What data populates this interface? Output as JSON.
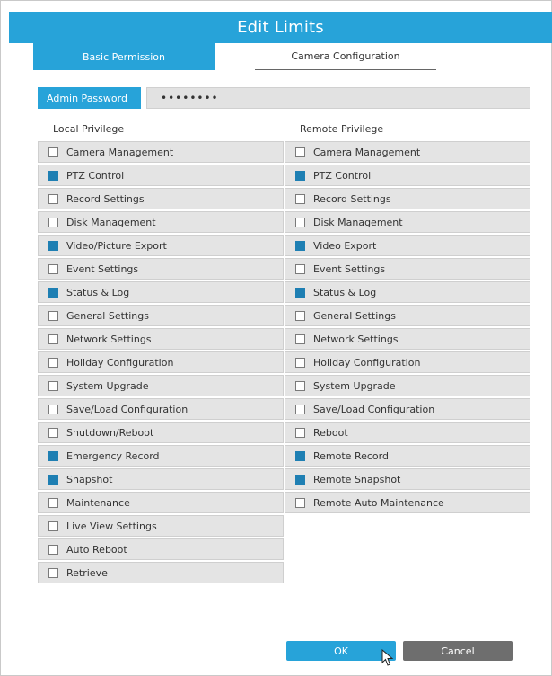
{
  "dialog": {
    "title": "Edit Limits",
    "tabs": [
      "Basic Permission",
      "Camera Configuration"
    ],
    "password_label": "Admin Password",
    "password_value": "••••••••",
    "local_title": "Local Privilege",
    "remote_title": "Remote Privilege",
    "ok": "OK",
    "cancel": "Cancel"
  },
  "local": [
    {
      "label": "Camera Management",
      "checked": false
    },
    {
      "label": "PTZ Control",
      "checked": true
    },
    {
      "label": "Record Settings",
      "checked": false
    },
    {
      "label": "Disk Management",
      "checked": false
    },
    {
      "label": "Video/Picture Export",
      "checked": true
    },
    {
      "label": "Event Settings",
      "checked": false
    },
    {
      "label": "Status & Log",
      "checked": true
    },
    {
      "label": "General Settings",
      "checked": false
    },
    {
      "label": "Network Settings",
      "checked": false
    },
    {
      "label": "Holiday Configuration",
      "checked": false
    },
    {
      "label": "System Upgrade",
      "checked": false
    },
    {
      "label": "Save/Load Configuration",
      "checked": false
    },
    {
      "label": "Shutdown/Reboot",
      "checked": false
    },
    {
      "label": "Emergency Record",
      "checked": true
    },
    {
      "label": "Snapshot",
      "checked": true
    },
    {
      "label": "Maintenance",
      "checked": false
    },
    {
      "label": "Live View Settings",
      "checked": false
    },
    {
      "label": "Auto Reboot",
      "checked": false
    },
    {
      "label": "Retrieve",
      "checked": false
    }
  ],
  "remote": [
    {
      "label": "Camera Management",
      "checked": false
    },
    {
      "label": "PTZ Control",
      "checked": true
    },
    {
      "label": "Record Settings",
      "checked": false
    },
    {
      "label": "Disk Management",
      "checked": false
    },
    {
      "label": "Video Export",
      "checked": true
    },
    {
      "label": "Event Settings",
      "checked": false
    },
    {
      "label": "Status & Log",
      "checked": true
    },
    {
      "label": "General Settings",
      "checked": false
    },
    {
      "label": "Network Settings",
      "checked": false
    },
    {
      "label": "Holiday Configuration",
      "checked": false
    },
    {
      "label": "System Upgrade",
      "checked": false
    },
    {
      "label": "Save/Load Configuration",
      "checked": false
    },
    {
      "label": "Reboot",
      "checked": false
    },
    {
      "label": "Remote Record",
      "checked": true
    },
    {
      "label": "Remote Snapshot",
      "checked": true
    },
    {
      "label": "Remote Auto Maintenance",
      "checked": false
    }
  ]
}
